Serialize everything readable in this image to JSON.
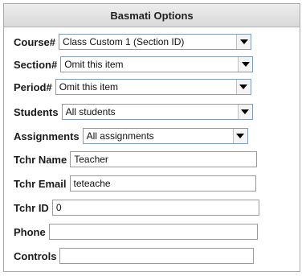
{
  "panel": {
    "title": "Basmati Options"
  },
  "fields": {
    "course": {
      "label": "Course#",
      "value": "Class Custom 1 (Section ID)"
    },
    "section": {
      "label": "Section#",
      "value": "Omit this item"
    },
    "period": {
      "label": "Period#",
      "value": "Omit this item"
    },
    "students": {
      "label": "Students",
      "value": "All students"
    },
    "assignments": {
      "label": "Assignments",
      "value": "All assignments"
    },
    "tchr_name": {
      "label": "Tchr Name",
      "value": "Teacher"
    },
    "tchr_email": {
      "label": "Tchr Email",
      "value": "teteache"
    },
    "tchr_id": {
      "label": "Tchr ID",
      "value": "0"
    },
    "phone": {
      "label": "Phone",
      "value": ""
    },
    "controls": {
      "label": "Controls",
      "value": ""
    }
  },
  "icons": {
    "dropdown": "chevron-down-icon"
  }
}
